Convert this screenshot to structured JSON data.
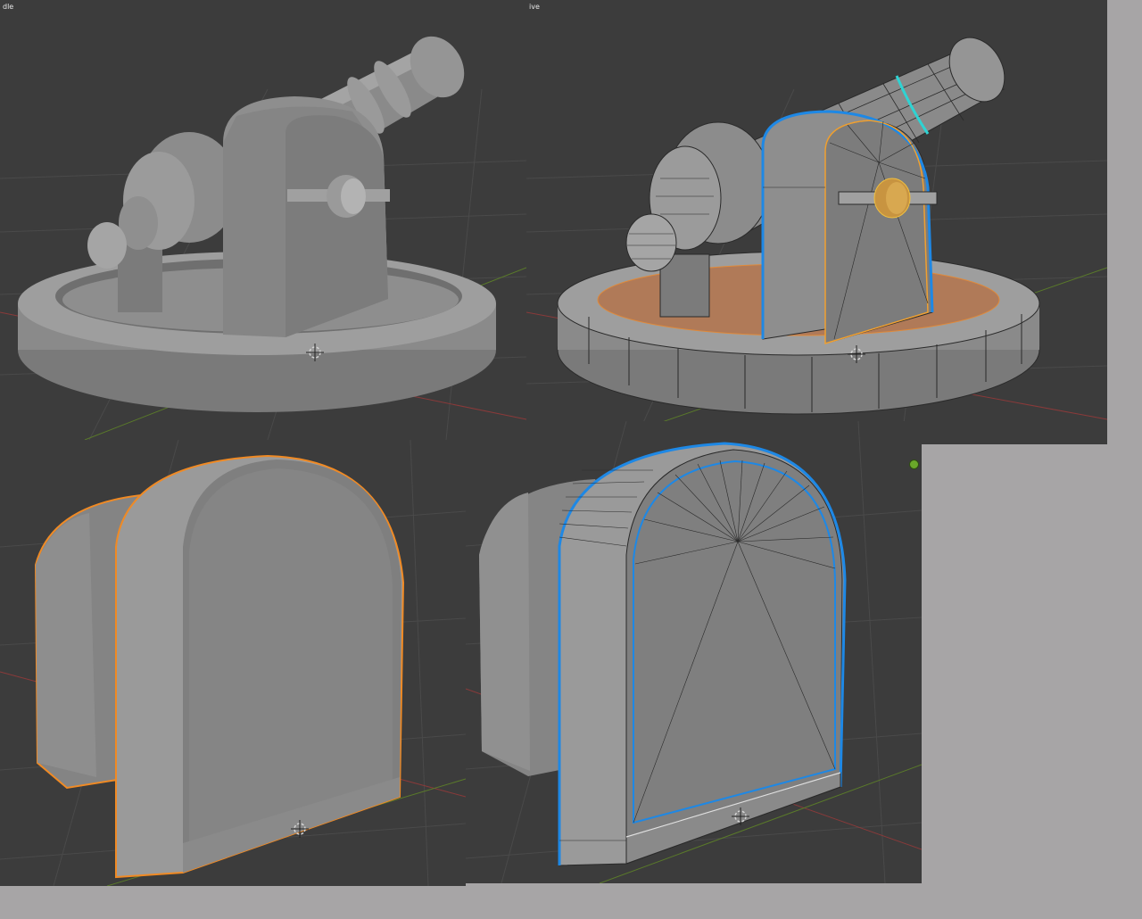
{
  "viewports": {
    "top_left": {
      "header_label": "dle",
      "shading": "solid"
    },
    "top_right": {
      "header_label": "ive",
      "shading": "wireframe-overlay"
    },
    "bottom_left": {
      "header_label": "",
      "shading": "solid-selected"
    },
    "bottom_right": {
      "header_label": "",
      "shading": "wireframe-overlay"
    }
  },
  "icons": {
    "cursor": "3d-cursor-icon",
    "gizmo": "navigation-gizmo-icon"
  },
  "colors": {
    "viewport_bg": "#3c3c3c",
    "page_bg": "#a7a5a6",
    "selection_outline": "#f08a24",
    "edge_highlight": "#1e88e5",
    "seam_cyan": "#2fd3d3",
    "face_selected": "#b07a58",
    "grid_red": "#8a3a3a",
    "grid_green": "#5a7a2a"
  }
}
